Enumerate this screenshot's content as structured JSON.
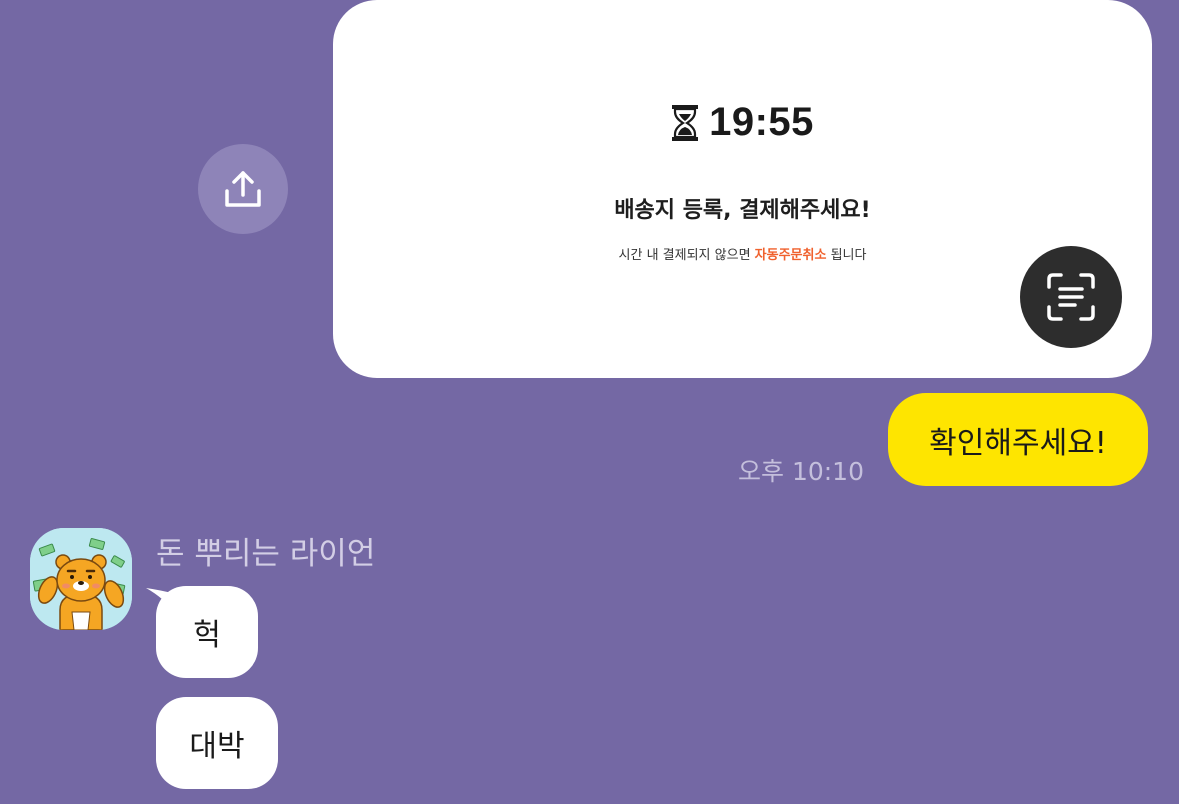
{
  "card": {
    "timer": "19:55",
    "title": "배송지 등록, 결제해주세요!",
    "note_prefix": "시간 내 결제되지 않으면 ",
    "note_highlight": "자동주문취소",
    "note_suffix": " 됩니다"
  },
  "my_message": {
    "text": "확인해주세요!",
    "time": "오후 10:10"
  },
  "friend": {
    "name": "돈 뿌리는 라이언",
    "messages": [
      "헉",
      "대박"
    ]
  },
  "colors": {
    "background": "#7468a4",
    "my_bubble": "#fee500",
    "friend_bubble": "#ffffff",
    "highlight": "#f0612d"
  },
  "icons": {
    "share": "share-upload-icon",
    "timer": "hourglass-icon",
    "scan": "text-scan-icon"
  }
}
